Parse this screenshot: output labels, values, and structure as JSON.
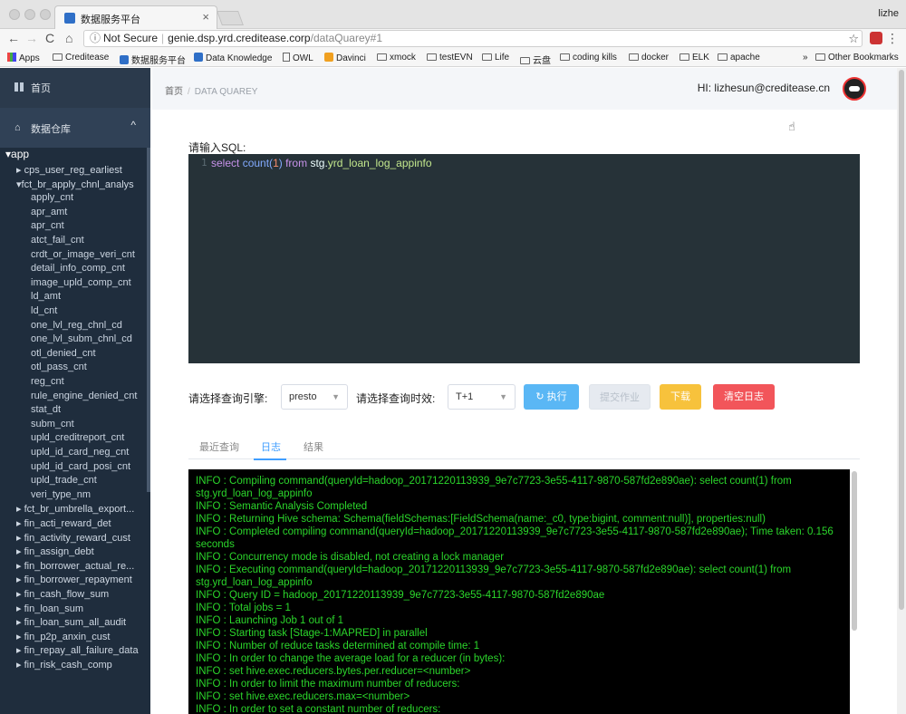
{
  "browser": {
    "tab_title": "数据服务平台",
    "tab_close": "×",
    "profile": "lizhe",
    "nav": {
      "back": "←",
      "forward": "→",
      "reload": "C",
      "home": "⌂"
    },
    "url": {
      "security": "Not Secure",
      "host": "genie.dsp.yrd.creditease.corp",
      "path": "/dataQuarey#1"
    },
    "star": "☆",
    "menu": "⋮",
    "bookmarks": [
      {
        "label": "Apps",
        "icon": "apps-icon"
      },
      {
        "label": "Creditease",
        "icon": "folder-icon"
      },
      {
        "label": "数据服务平台",
        "icon": "site-icon"
      },
      {
        "label": "Data Knowledge",
        "icon": "site-icon"
      },
      {
        "label": "OWL",
        "icon": "page-icon"
      },
      {
        "label": "Davinci",
        "icon": "davinci-icon"
      },
      {
        "label": "xmock",
        "icon": "folder-icon"
      },
      {
        "label": "testEVN",
        "icon": "folder-icon"
      },
      {
        "label": "Life",
        "icon": "folder-icon"
      },
      {
        "label": "云盘",
        "icon": "folder-icon"
      },
      {
        "label": "coding kills",
        "icon": "folder-icon"
      },
      {
        "label": "docker",
        "icon": "folder-icon"
      },
      {
        "label": "ELK",
        "icon": "folder-icon"
      },
      {
        "label": "apache",
        "icon": "folder-icon"
      }
    ],
    "more": "»",
    "other_bookmarks": "Other Bookmarks"
  },
  "sidebar": {
    "home": "首页",
    "warehouse": "数据仓库",
    "chevron": "^",
    "tree": {
      "root": "▾app",
      "items": [
        {
          "label": "▸ cps_user_reg_earliest",
          "level": 1
        },
        {
          "label": "▾fct_br_apply_chnl_analys",
          "level": 1
        },
        {
          "label": "apply_cnt",
          "level": 2
        },
        {
          "label": "apr_amt",
          "level": 2
        },
        {
          "label": "apr_cnt",
          "level": 2
        },
        {
          "label": "atct_fail_cnt",
          "level": 2
        },
        {
          "label": "crdt_or_image_veri_cnt",
          "level": 2
        },
        {
          "label": "detail_info_comp_cnt",
          "level": 2
        },
        {
          "label": "image_upld_comp_cnt",
          "level": 2
        },
        {
          "label": "ld_amt",
          "level": 2
        },
        {
          "label": "ld_cnt",
          "level": 2
        },
        {
          "label": "one_lvl_reg_chnl_cd",
          "level": 2
        },
        {
          "label": "one_lvl_subm_chnl_cd",
          "level": 2
        },
        {
          "label": "otl_denied_cnt",
          "level": 2
        },
        {
          "label": "otl_pass_cnt",
          "level": 2
        },
        {
          "label": "reg_cnt",
          "level": 2
        },
        {
          "label": "rule_engine_denied_cnt",
          "level": 2
        },
        {
          "label": "stat_dt",
          "level": 2
        },
        {
          "label": "subm_cnt",
          "level": 2
        },
        {
          "label": "upld_creditreport_cnt",
          "level": 2
        },
        {
          "label": "upld_id_card_neg_cnt",
          "level": 2
        },
        {
          "label": "upld_id_card_posi_cnt",
          "level": 2
        },
        {
          "label": "upld_trade_cnt",
          "level": 2
        },
        {
          "label": "veri_type_nm",
          "level": 2
        },
        {
          "label": "▸ fct_br_umbrella_export...",
          "level": 1
        },
        {
          "label": "▸ fin_acti_reward_det",
          "level": 1
        },
        {
          "label": "▸ fin_activity_reward_cust",
          "level": 1
        },
        {
          "label": "▸ fin_assign_debt",
          "level": 1
        },
        {
          "label": "▸ fin_borrower_actual_re...",
          "level": 1
        },
        {
          "label": "▸ fin_borrower_repayment",
          "level": 1
        },
        {
          "label": "▸ fin_cash_flow_sum",
          "level": 1
        },
        {
          "label": "▸ fin_loan_sum",
          "level": 1
        },
        {
          "label": "▸ fin_loan_sum_all_audit",
          "level": 1
        },
        {
          "label": "▸ fin_p2p_anxin_cust",
          "level": 1
        },
        {
          "label": "▸ fin_repay_all_failure_data",
          "level": 1
        },
        {
          "label": "▸ fin_risk_cash_comp",
          "level": 1
        }
      ]
    }
  },
  "header": {
    "breadcrumb_home": "首页",
    "breadcrumb_sep": "/",
    "breadcrumb_current": "DATA QUAREY",
    "greeting": "HI:  lizhesun@creditease.cn"
  },
  "editor": {
    "label": "请输入SQL:",
    "line_number": "1",
    "tokens": {
      "select": "select",
      "count": "count(",
      "one": "1",
      "close": ")",
      "from": "from",
      "schema": "stg.",
      "table": "yrd_loan_log_appinfo"
    }
  },
  "controls": {
    "engine_label": "请选择查询引擎:",
    "engine_value": "presto",
    "timeliness_label": "请选择查询时效:",
    "timeliness_value": "T+1",
    "caret": "▼",
    "run_label": "↻ 执行",
    "submit_label": "提交作业",
    "download_label": "下载",
    "clear_label": "清空日志"
  },
  "tabs": [
    {
      "label": "最近查询",
      "active": false
    },
    {
      "label": "日志",
      "active": true
    },
    {
      "label": "结果",
      "active": false
    }
  ],
  "log": [
    "INFO : Compiling command(queryId=hadoop_20171220113939_9e7c7723-3e55-4117-9870-587fd2e890ae): select count(1) from stg.yrd_loan_log_appinfo",
    "INFO : Semantic Analysis Completed",
    "INFO : Returning Hive schema: Schema(fieldSchemas:[FieldSchema(name:_c0, type:bigint, comment:null)], properties:null)",
    "INFO : Completed compiling command(queryId=hadoop_20171220113939_9e7c7723-3e55-4117-9870-587fd2e890ae); Time taken: 0.156 seconds",
    "INFO : Concurrency mode is disabled, not creating a lock manager",
    "INFO : Executing command(queryId=hadoop_20171220113939_9e7c7723-3e55-4117-9870-587fd2e890ae): select count(1) from stg.yrd_loan_log_appinfo",
    "INFO : Query ID = hadoop_20171220113939_9e7c7723-3e55-4117-9870-587fd2e890ae",
    "INFO : Total jobs = 1",
    "INFO : Launching Job 1 out of 1",
    "INFO : Starting task [Stage-1:MAPRED] in parallel",
    "INFO : Number of reduce tasks determined at compile time: 1",
    "INFO : In order to change the average load for a reducer (in bytes):",
    "INFO : set hive.exec.reducers.bytes.per.reducer=<number>",
    "INFO : In order to limit the maximum number of reducers:",
    "INFO : set hive.exec.reducers.max=<number>",
    "INFO : In order to set a constant number of reducers:"
  ],
  "colors": {
    "sidebar": "#304156",
    "tree": "#1f2d3d",
    "log_text": "#2bd62b",
    "editor_bg": "#263238",
    "run": "#5ab7f5",
    "download": "#f7c23c",
    "clear": "#f2555a",
    "active_tab": "#409eff"
  }
}
